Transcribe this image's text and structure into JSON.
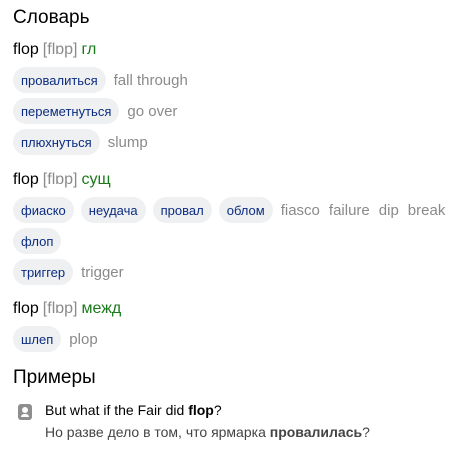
{
  "dictionary": {
    "title": "Словарь",
    "entries": [
      {
        "word": "flop",
        "transcription": "[flɒp]",
        "pos": "гл",
        "rows": [
          {
            "chips": [
              "провалиться"
            ],
            "english": [
              "fall through"
            ]
          },
          {
            "chips": [
              "переметнуться"
            ],
            "english": [
              "go over"
            ]
          },
          {
            "chips": [
              "плюхнуться"
            ],
            "english": [
              "slump"
            ]
          }
        ]
      },
      {
        "word": "flop",
        "transcription": "[flɒp]",
        "pos": "сущ",
        "rows": [
          {
            "chips": [
              "фиаско",
              "неудача",
              "провал",
              "облом"
            ],
            "english": [
              "fiasco",
              "failure",
              "dip",
              "break"
            ]
          },
          {
            "chips": [
              "флоп"
            ],
            "english": []
          },
          {
            "chips": [
              "триггер"
            ],
            "english": [
              "trigger"
            ]
          }
        ]
      },
      {
        "word": "flop",
        "transcription": "[flɒp]",
        "pos": "межд",
        "rows": [
          {
            "chips": [
              "шлеп"
            ],
            "english": [
              "plop"
            ]
          }
        ]
      }
    ]
  },
  "examples": {
    "title": "Примеры",
    "items": [
      {
        "icon": "book-icon",
        "en_before": "But what if the Fair did ",
        "en_bold": "flop",
        "en_after": "?",
        "ru_before": "Но разве дело в том, что ярмарка ",
        "ru_bold": "провалилась",
        "ru_after": "?"
      }
    ]
  }
}
